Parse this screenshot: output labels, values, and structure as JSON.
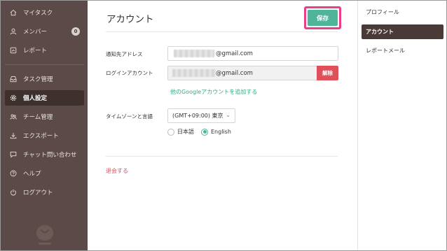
{
  "sidebar": {
    "items": [
      {
        "label": "マイタスク",
        "icon": "home-icon"
      },
      {
        "label": "メンバー",
        "icon": "user-icon",
        "badge": "0"
      },
      {
        "label": "レポート",
        "icon": "report-icon"
      },
      {
        "label": "タスク管理",
        "icon": "inbox-icon"
      },
      {
        "label": "個人設定",
        "icon": "gear-icon",
        "active": true
      },
      {
        "label": "チーム管理",
        "icon": "team-icon"
      },
      {
        "label": "エクスポート",
        "icon": "download-icon"
      },
      {
        "label": "チャット問い合わせ",
        "icon": "chat-icon"
      },
      {
        "label": "ヘルプ",
        "icon": "help-icon"
      },
      {
        "label": "ログアウト",
        "icon": "power-icon"
      }
    ]
  },
  "main": {
    "title": "アカウント",
    "save_label": "保存",
    "notify_label": "通知先アドレス",
    "notify_value": "@gmail.com",
    "login_label": "ログインアカウント",
    "login_value": "@gmail.com",
    "delete_label": "解除",
    "add_google_link": "他のGoogleアカウントを追加する",
    "tz_label": "タイムゾーンと言語",
    "tz_value": "(GMT+09:00) 東京",
    "lang_options": [
      "日本語",
      "English"
    ],
    "lang_selected": "English",
    "withdraw_label": "退会する"
  },
  "right_panel": {
    "items": [
      {
        "label": "プロフィール"
      },
      {
        "label": "アカウント",
        "active": true
      },
      {
        "label": "レポートメール"
      }
    ]
  },
  "colors": {
    "sidebar_bg": "#5b4a47",
    "accent": "#4fb59a",
    "danger": "#e0505a",
    "highlight": "#e83e8c"
  }
}
